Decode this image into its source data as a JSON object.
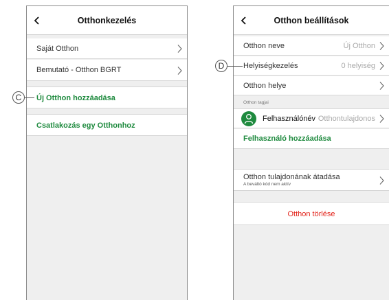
{
  "left_screen": {
    "title": "Otthonkezelés",
    "rows": [
      {
        "label": "Saját Otthon"
      },
      {
        "label": "Bemutató - Otthon BGRT"
      }
    ],
    "add_home_label": "Új Otthon hozzáadása",
    "join_home_label": "Csatlakozás egy Otthonhoz"
  },
  "right_screen": {
    "title": "Otthon beállítások",
    "home_name": {
      "label": "Otthon neve",
      "value": "Új Otthon"
    },
    "room_management": {
      "label": "Helyiségkezelés",
      "value": "0 helyiség"
    },
    "home_location": {
      "label": "Otthon helye"
    },
    "members_section": "Otthon tagjai",
    "member": {
      "name": "Felhasználónév",
      "role": "Otthontulajdonos"
    },
    "add_user_label": "Felhasználó hozzáadása",
    "transfer_owner": {
      "label": "Otthon tulajdonának átadása",
      "sublabel": "A beváltó kód nem aktív"
    },
    "delete_home_label": "Otthon törlése"
  },
  "callouts": {
    "c": "C",
    "d": "D"
  },
  "colors": {
    "accent_green": "#1e8a3e",
    "danger_red": "#e2231a",
    "background": "#efefef"
  },
  "icons": {
    "back": "chevron-left-icon",
    "row_arrow": "chevron-right-icon",
    "avatar": "user-icon"
  }
}
